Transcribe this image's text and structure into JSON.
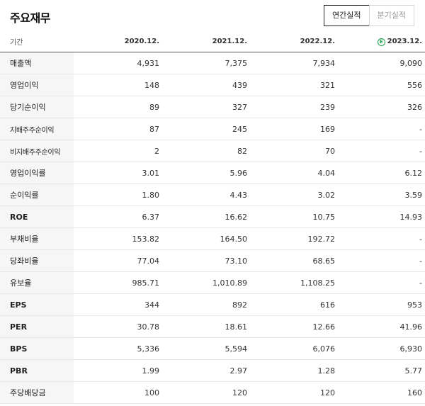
{
  "title": "주요재무",
  "toggle": {
    "annual": "연간실적",
    "quarterly": "분기실적"
  },
  "header": {
    "label": "기간",
    "periods": [
      "2020.12.",
      "2021.12.",
      "2022.12.",
      "2023.12."
    ],
    "estimate_marker": "E"
  },
  "rows": [
    {
      "label": "매출액",
      "values": [
        "4,931",
        "7,375",
        "7,934",
        "9,090"
      ]
    },
    {
      "label": "영업이익",
      "values": [
        "148",
        "439",
        "321",
        "556"
      ]
    },
    {
      "label": "당기순이익",
      "values": [
        "89",
        "327",
        "239",
        "326"
      ]
    },
    {
      "label": "지배주주순이익",
      "values": [
        "87",
        "245",
        "169",
        "-"
      ]
    },
    {
      "label": "비지배주주순이익",
      "values": [
        "2",
        "82",
        "70",
        "-"
      ]
    },
    {
      "label": "영업이익률",
      "values": [
        "3.01",
        "5.96",
        "4.04",
        "6.12"
      ]
    },
    {
      "label": "순이익률",
      "values": [
        "1.80",
        "4.43",
        "3.02",
        "3.59"
      ]
    },
    {
      "label": "ROE",
      "values": [
        "6.37",
        "16.62",
        "10.75",
        "14.93"
      ]
    },
    {
      "label": "부채비율",
      "values": [
        "153.82",
        "164.50",
        "192.72",
        "-"
      ]
    },
    {
      "label": "당좌비율",
      "values": [
        "77.04",
        "73.10",
        "68.65",
        "-"
      ]
    },
    {
      "label": "유보율",
      "values": [
        "985.71",
        "1,010.89",
        "1,108.25",
        "-"
      ]
    },
    {
      "label": "EPS",
      "values": [
        "344",
        "892",
        "616",
        "953"
      ]
    },
    {
      "label": "PER",
      "values": [
        "30.78",
        "18.61",
        "12.66",
        "41.96"
      ]
    },
    {
      "label": "BPS",
      "values": [
        "5,336",
        "5,594",
        "6,076",
        "6,930"
      ]
    },
    {
      "label": "PBR",
      "values": [
        "1.99",
        "2.97",
        "1.28",
        "5.77"
      ]
    },
    {
      "label": "주당배당금",
      "values": [
        "100",
        "120",
        "120",
        "160"
      ]
    }
  ],
  "colors": {
    "estimate": "#1ea54c",
    "label_bg": "#f6f6f6"
  }
}
